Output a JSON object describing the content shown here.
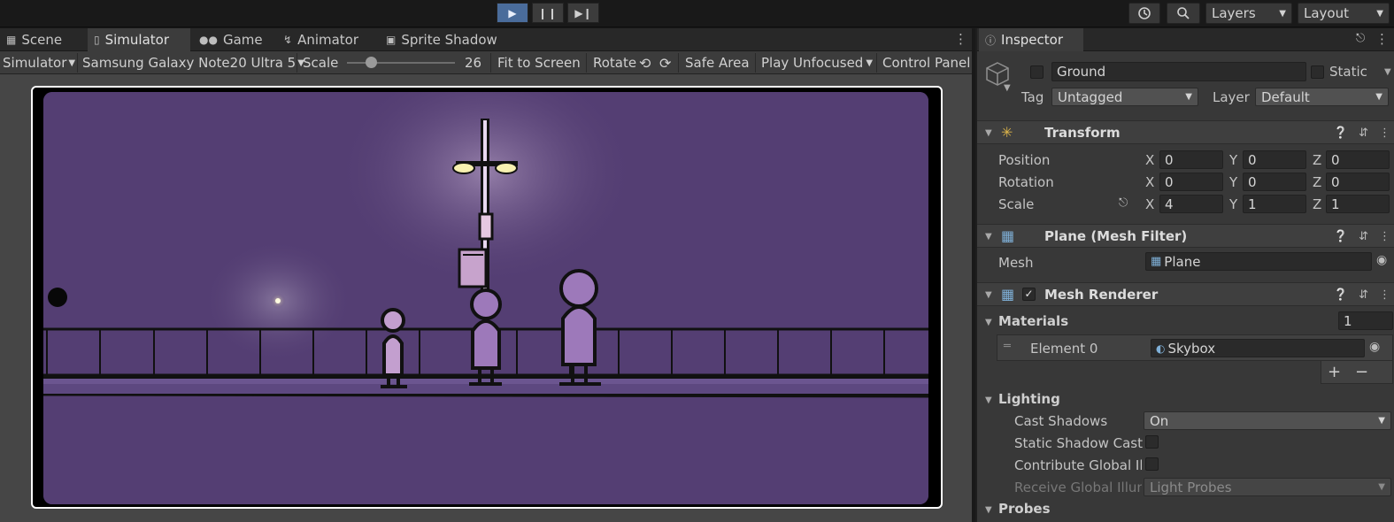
{
  "toolbar": {
    "layers_label": "Layers",
    "layout_label": "Layout",
    "play_active": true
  },
  "tabs_left": [
    {
      "label": "Scene",
      "icon": "grid-icon"
    },
    {
      "label": "Simulator",
      "icon": "phone-icon",
      "active": true
    },
    {
      "label": "Game",
      "icon": "gamepad-icon"
    },
    {
      "label": "Animator",
      "icon": "animator-icon"
    },
    {
      "label": "Sprite Shadow",
      "icon": "sprite-shadow-icon"
    }
  ],
  "simulator_bar": {
    "mode": "Simulator",
    "device": "Samsung Galaxy Note20 Ultra 5",
    "scale_label": "Scale",
    "scale_value": "26",
    "scale_slider_fraction": 0.22,
    "fit_to_screen": "Fit to Screen",
    "rotate": "Rotate",
    "safe_area": "Safe Area",
    "play_mode": "Play Unfocused",
    "control_panel": "Control Panel"
  },
  "inspector": {
    "tab_label": "Inspector",
    "object": {
      "name": "Ground",
      "static_label": "Static",
      "tag_label": "Tag",
      "tag_value": "Untagged",
      "layer_label": "Layer",
      "layer_value": "Default"
    },
    "transform": {
      "title": "Transform",
      "rows": [
        {
          "label": "Position",
          "x": "0",
          "y": "0",
          "z": "0"
        },
        {
          "label": "Rotation",
          "x": "0",
          "y": "0",
          "z": "0"
        },
        {
          "label": "Scale",
          "x": "4",
          "y": "1",
          "z": "1"
        }
      ],
      "axis_x": "X",
      "axis_y": "Y",
      "axis_z": "Z"
    },
    "mesh_filter": {
      "title": "Plane (Mesh Filter)",
      "mesh_label": "Mesh",
      "mesh_value": "Plane"
    },
    "mesh_renderer": {
      "title": "Mesh Renderer",
      "enabled": true,
      "materials_label": "Materials",
      "materials_count": "1",
      "element_label": "Element 0",
      "element_value": "Skybox",
      "add": "+",
      "remove": "−",
      "lighting_label": "Lighting",
      "cast_shadows_label": "Cast Shadows",
      "cast_shadows_value": "On",
      "static_shadow_label": "Static Shadow Cast",
      "contribute_gi_label": "Contribute Global Illu",
      "receive_gi_label": "Receive Global Illum",
      "receive_gi_value": "Light Probes",
      "probes_label": "Probes"
    }
  }
}
